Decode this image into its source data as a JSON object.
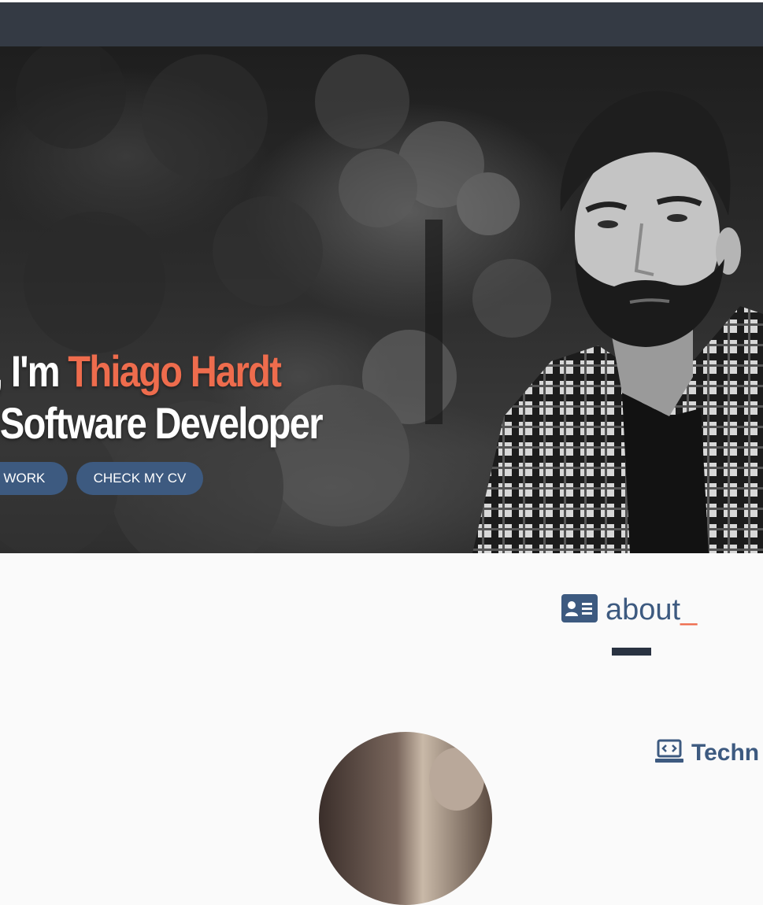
{
  "hero": {
    "greeting": "o, I'm ",
    "name": "Thiago Hardt",
    "tagline": "a Software Developer",
    "buttons": {
      "work": "Y WORK",
      "cv": "CHECK MY CV"
    }
  },
  "about": {
    "title": "about",
    "cursor": "_",
    "icon": "id-card-icon"
  },
  "technologies": {
    "label": "Techn",
    "icon": "laptop-code-icon"
  },
  "colors": {
    "navbar": "#343a44",
    "accent": "#ee6c4d",
    "primary": "#3d5a80",
    "divider": "#293241",
    "background": "#fafafa"
  }
}
